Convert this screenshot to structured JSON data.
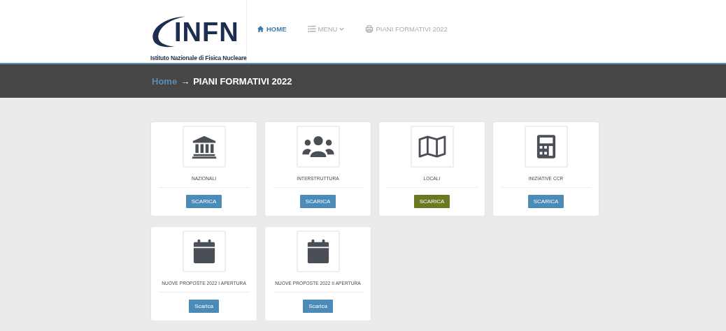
{
  "logo": {
    "wordmark_left": "INFN",
    "subtitle": "Istituto Nazionale di Fisica Nucleare"
  },
  "nav": [
    {
      "label": "HOME",
      "kind": "home",
      "selected": true
    },
    {
      "label": "MENU",
      "kind": "list",
      "selected": false
    },
    {
      "label": "PIANI FORMATIVI 2022",
      "kind": "print",
      "selected": false
    }
  ],
  "breadcrumb": {
    "home": "Home",
    "separator": "→",
    "current": "PIANI FORMATIVI 2022"
  },
  "cards": [
    {
      "title": "NAZIONALI",
      "kind": "bank",
      "button": "SCARICA",
      "hovered": false
    },
    {
      "title": "INTERSTRUTTURA",
      "kind": "users",
      "button": "SCARICA",
      "hovered": false
    },
    {
      "title": "LOCALI",
      "kind": "map",
      "button": "SCARICA",
      "hovered": true
    },
    {
      "title": "INIZIATIVE CCR",
      "kind": "calculator",
      "button": "SCARICA",
      "hovered": false
    },
    {
      "title": "NUOVE PROPOSTE 2022 I APERTURA",
      "kind": "calendar",
      "button": "Scarica",
      "hovered": false
    },
    {
      "title": "NUOVE PROPOSTE 2022 II APERTURA",
      "kind": "calendar",
      "button": "Scarica",
      "hovered": false
    }
  ]
}
